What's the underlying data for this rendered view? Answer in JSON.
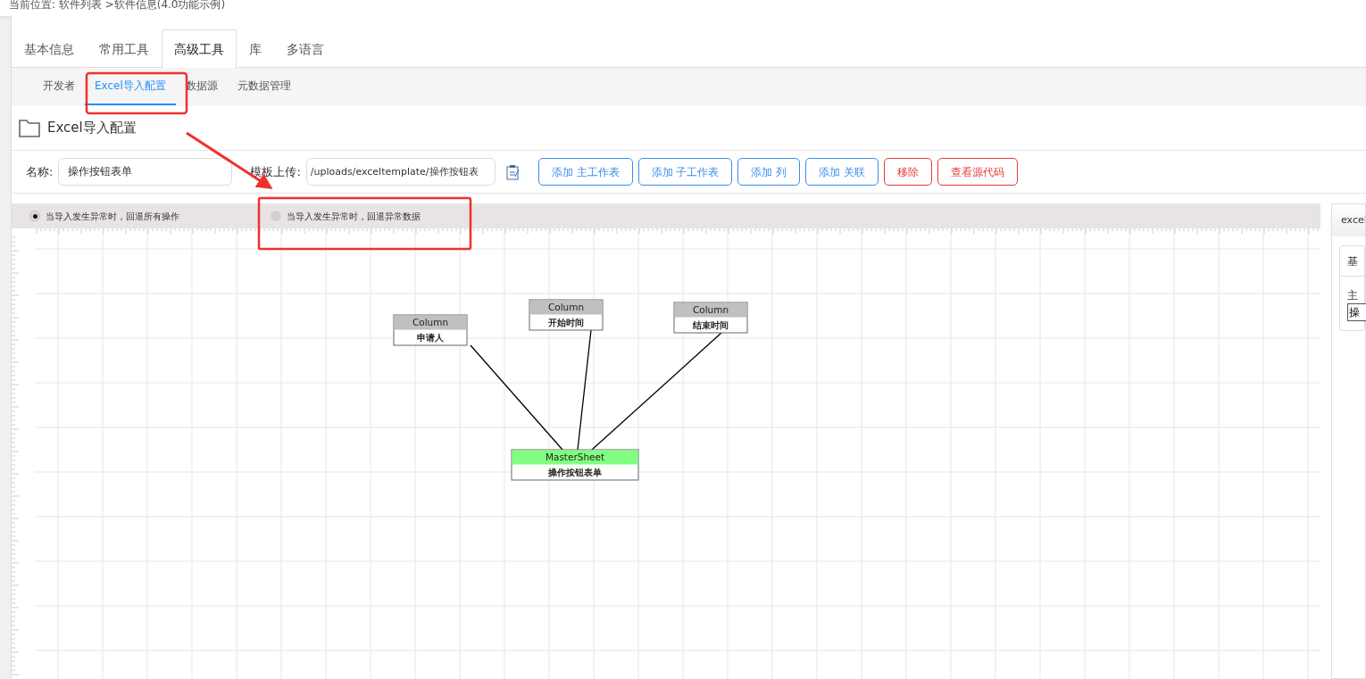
{
  "breadcrumb": "当前位置: 软件列表 >软件信息(4.0功能示例)",
  "tabs": [
    {
      "label": "基本信息",
      "selected": false
    },
    {
      "label": "常用工具",
      "selected": false
    },
    {
      "label": "高级工具",
      "selected": true
    },
    {
      "label": "库",
      "selected": false
    },
    {
      "label": "多语言",
      "selected": false
    }
  ],
  "subtabs": [
    {
      "label": "开发者",
      "selected": false
    },
    {
      "label": "Excel导入配置",
      "selected": true
    },
    {
      "label": "数据源",
      "selected": false
    },
    {
      "label": "元数据管理",
      "selected": false
    }
  ],
  "section_title": "Excel导入配置",
  "form": {
    "name_label": "名称:",
    "name_value": "操作按钮表单",
    "template_label": "模板上传:",
    "template_value": "/uploads/exceltemplate/操作按钮表"
  },
  "buttons": [
    {
      "label": "添加 主工作表",
      "kind": "primary"
    },
    {
      "label": "添加 子工作表",
      "kind": "primary"
    },
    {
      "label": "添加 列",
      "kind": "primary"
    },
    {
      "label": "添加 关联",
      "kind": "primary"
    },
    {
      "label": "移除",
      "kind": "danger"
    },
    {
      "label": "查看源代码",
      "kind": "danger"
    }
  ],
  "rollback_options": [
    {
      "label": "当导入发生异常时，回退所有操作",
      "selected": true
    },
    {
      "label": "当导入发生异常时，回退异常数据",
      "selected": false
    }
  ],
  "diagram": {
    "nodes": [
      {
        "type": "Column",
        "name": "申请人",
        "kind": "column"
      },
      {
        "type": "Column",
        "name": "开始时间",
        "kind": "column"
      },
      {
        "type": "Column",
        "name": "结束时间",
        "kind": "column"
      },
      {
        "type": "MasterSheet",
        "name": "操作按钮表单",
        "kind": "master"
      }
    ]
  },
  "side_panel": {
    "title": "excel",
    "tab": "基",
    "field_label": "主",
    "field_value": "操"
  }
}
